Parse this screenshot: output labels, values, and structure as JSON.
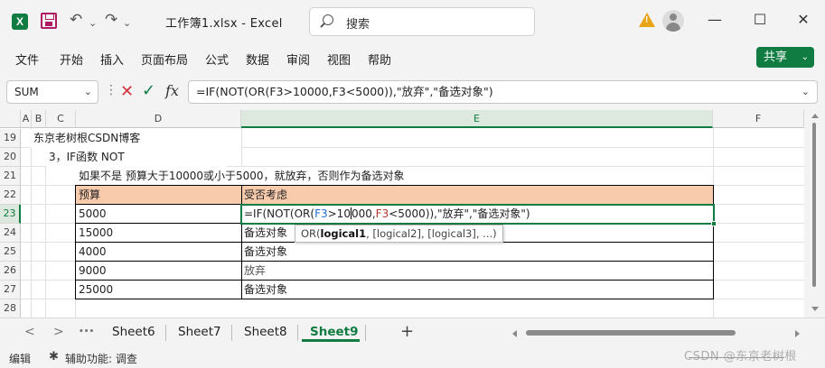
{
  "titlebar": {
    "doc_title": "工作簿1.xlsx  -  Excel",
    "search_placeholder": "搜索",
    "undo_glyph": "↶",
    "redo_glyph": "↷",
    "dropdown_glyph": "⌄",
    "minimize": "—",
    "maximize": "☐",
    "close": "✕"
  },
  "menu": [
    "文件",
    "开始",
    "插入",
    "页面布局",
    "公式",
    "数据",
    "审阅",
    "视图",
    "帮助"
  ],
  "share": {
    "label": "共享",
    "chevron": "⌄"
  },
  "formula_bar": {
    "name_box": "SUM",
    "formula": "=IF(NOT(OR(F3>10000,F3<5000)),\"放弃\",\"备选对象\")",
    "fx": "fx"
  },
  "columns": [
    "A",
    "B",
    "C",
    "D",
    "E",
    "F"
  ],
  "rows": [
    "19",
    "20",
    "21",
    "22",
    "23",
    "24",
    "25",
    "26",
    "27",
    "28"
  ],
  "sheet": {
    "r19_text": "东京老树根CSDN博客",
    "r20_text": "3，IF函数 NOT",
    "r21_text": "如果不是 预算大于10000或小于5000，就放弃，否则作为备选对象",
    "table_headers": [
      "预算",
      "受否考虑"
    ],
    "table_rows": [
      [
        "5000",
        ""
      ],
      [
        "15000",
        "备选对象"
      ],
      [
        "4000",
        "备选对象"
      ],
      [
        "9000",
        "放弃"
      ],
      [
        "25000",
        "备选对象"
      ]
    ],
    "edit": {
      "p1": "=IF(NOT(OR(",
      "ref1": "F3",
      "p2": ">10",
      "p3": "000,",
      "ref2": "F3",
      "p4": "<5000)),\"放弃\",\"备选对象\")"
    }
  },
  "tooltip": {
    "fn": "OR(",
    "arg1": "logical1",
    "rest": ", [logical2], [logical3], ...)"
  },
  "tabs": {
    "prev": "<",
    "next": ">",
    "more": "•••",
    "sheets": [
      "Sheet6",
      "Sheet7",
      "Sheet8",
      "Sheet9"
    ],
    "active": "Sheet9",
    "add": "+"
  },
  "status": {
    "mode": "编辑",
    "accessibility": "辅助功能: 调查"
  },
  "watermark": "CSDN @东京老树根",
  "colors": {
    "accent": "#107c41",
    "header_fill": "#f8cbad",
    "ref_blue": "#1f6fd1",
    "ref_red": "#b03a2e"
  }
}
